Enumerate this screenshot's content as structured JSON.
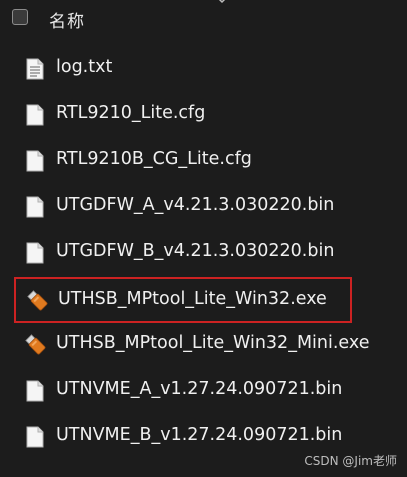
{
  "header": {
    "column_label": "名称"
  },
  "files": [
    {
      "name": "log.txt",
      "icon": "text-file-icon"
    },
    {
      "name": "RTL9210_Lite.cfg",
      "icon": "blank-file-icon"
    },
    {
      "name": "RTL9210B_CG_Lite.cfg",
      "icon": "blank-file-icon"
    },
    {
      "name": "UTGDFW_A_v4.21.3.030220.bin",
      "icon": "blank-file-icon"
    },
    {
      "name": "UTGDFW_B_v4.21.3.030220.bin",
      "icon": "blank-file-icon"
    },
    {
      "name": "UTHSB_MPtool_Lite_Win32.exe",
      "icon": "usb-drive-icon"
    },
    {
      "name": "UTHSB_MPtool_Lite_Win32_Mini.exe",
      "icon": "usb-drive-icon"
    },
    {
      "name": "UTNVME_A_v1.27.24.090721.bin",
      "icon": "blank-file-icon"
    },
    {
      "name": "UTNVME_B_v1.27.24.090721.bin",
      "icon": "blank-file-icon"
    }
  ],
  "highlight": {
    "outline_color": "#cc2222"
  },
  "watermark": "CSDN @Jim老师"
}
